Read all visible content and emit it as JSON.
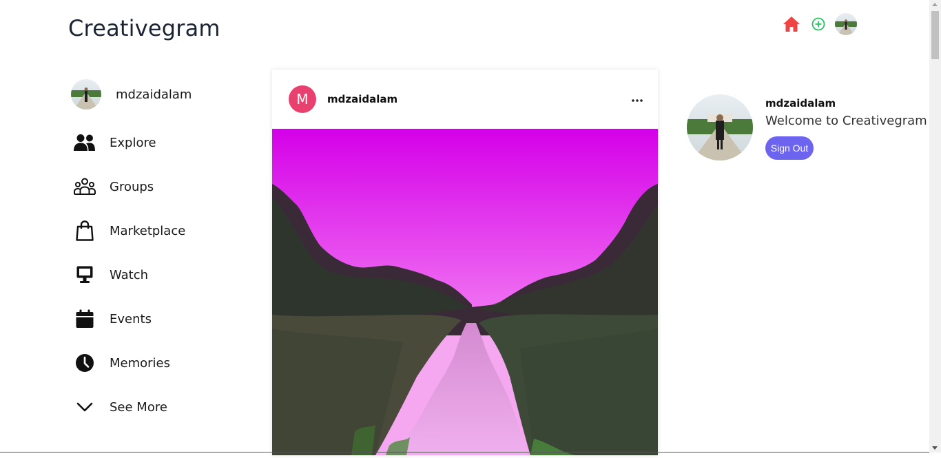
{
  "app": {
    "brand": "Creativegram"
  },
  "colors": {
    "home_icon": "#ef4444",
    "add_icon": "#22c55e",
    "post_avatar_bg": "#e8406f",
    "signout_bg": "#6c63ee"
  },
  "topnav": {
    "icons": [
      "home-icon",
      "add-circle-icon",
      "user-avatar"
    ]
  },
  "sidebar": {
    "profile_name": "mdzaidalam",
    "items": [
      {
        "label": "Explore",
        "icon": "people-icon"
      },
      {
        "label": "Groups",
        "icon": "groups-icon"
      },
      {
        "label": "Marketplace",
        "icon": "shopping-bag-icon"
      },
      {
        "label": "Watch",
        "icon": "monitor-icon"
      },
      {
        "label": "Events",
        "icon": "calendar-icon"
      },
      {
        "label": "Memories",
        "icon": "clock-icon"
      },
      {
        "label": "See More",
        "icon": "chevron-down-icon"
      }
    ]
  },
  "post": {
    "avatar_letter": "M",
    "username": "mdzaidalam",
    "more_icon": "more-horizontal-icon"
  },
  "right_panel": {
    "username": "mdzaidalam",
    "welcome": "Welcome to Creativegram",
    "signout_label": "Sign Out"
  }
}
